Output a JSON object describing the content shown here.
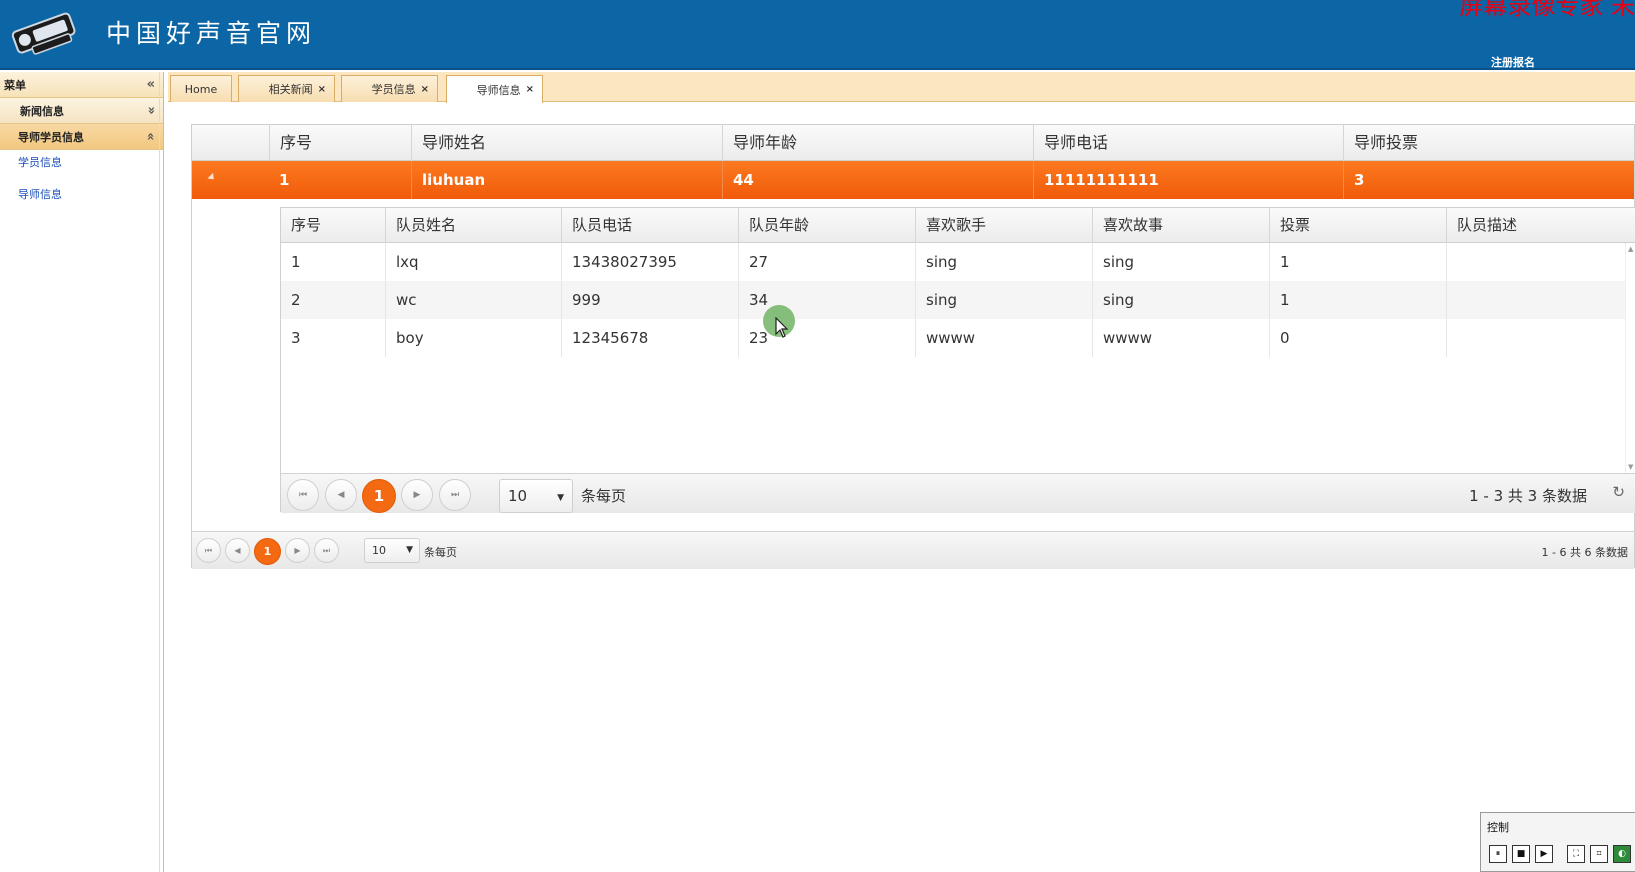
{
  "header": {
    "title": "中国好声音官网",
    "watermark": "屏幕录像专家 未",
    "register_link": "注册报名"
  },
  "sidebar": {
    "menu_label": "菜单",
    "menu_collapse_icon": "«",
    "sections": [
      {
        "label": "新闻信息",
        "icon": "»"
      },
      {
        "label": "导师学员信息",
        "icon": "»"
      }
    ],
    "links": [
      "学员信息",
      "导师信息"
    ]
  },
  "tabs": [
    {
      "label": "Home",
      "closable": false
    },
    {
      "label": "相关新闻",
      "closable": true
    },
    {
      "label": "学员信息",
      "closable": true
    },
    {
      "label": "导师信息",
      "closable": true,
      "active": true
    }
  ],
  "tab_close": "×",
  "main_grid": {
    "columns": [
      "序号",
      "导师姓名",
      "导师年龄",
      "导师电话",
      "导师投票"
    ],
    "selected_row": [
      "1",
      "liuhuan",
      "44",
      "11111111111",
      "3"
    ],
    "pager": {
      "current_page": "1",
      "page_size": "10",
      "per_page_label": "条每页",
      "info": "1 - 6 共 6 条数据"
    }
  },
  "detail_grid": {
    "columns": [
      "序号",
      "队员姓名",
      "队员电话",
      "队员年龄",
      "喜欢歌手",
      "喜欢故事",
      "投票",
      "队员描述"
    ],
    "rows": [
      [
        "1",
        "lxq",
        "13438027395",
        "27",
        "sing",
        "sing",
        "1",
        ""
      ],
      [
        "2",
        "wc",
        "999",
        "34",
        "sing",
        "sing",
        "1",
        ""
      ],
      [
        "3",
        "boy",
        "12345678",
        "23",
        "wwww",
        "wwww",
        "0",
        ""
      ]
    ],
    "pager": {
      "current_page": "1",
      "page_size": "10",
      "per_page_label": "条每页",
      "info": "1 - 3 共 3 条数据"
    }
  },
  "pager_icons": {
    "first": "⏮",
    "prev": "◀",
    "next": "▶",
    "last": "⏭",
    "dropdown": "▼",
    "refresh": "↻"
  },
  "control": {
    "label": "控制"
  }
}
